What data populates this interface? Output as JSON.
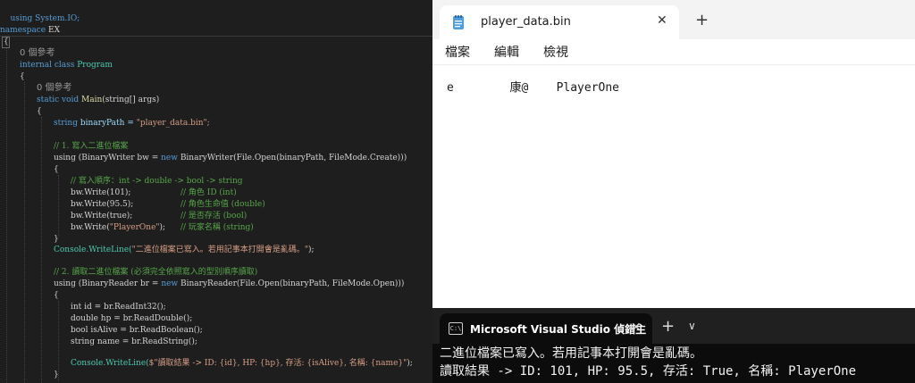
{
  "editor": {
    "using_line": "using System.IO;",
    "codelens_class": "0 個參考",
    "codelens_method": "0 個參考",
    "lines": {
      "namespace_kw": "namespace",
      "namespace_name": " EX",
      "open_ns": "{",
      "class_kw": "internal class ",
      "class_name": "Program",
      "open_class": "{",
      "static_kw": "static void ",
      "main_name": "Main",
      "main_params": "(string[] args)",
      "open_main": "{",
      "path_type": "string ",
      "path_decl": "binaryPath = ",
      "path_value": "\"player_data.bin\";",
      "comment_write": "// 1. 寫入二進位檔案",
      "using_writer_a": "using (BinaryWriter bw = ",
      "using_writer_b": "new ",
      "using_writer_c": "BinaryWriter(File.Open(binaryPath, FileMode.Create)))",
      "open_writer": "{",
      "comment_order": "// 寫入順序：int -> double -> bool -> string",
      "w1_code": "bw.Write(101);",
      "w1_comment": "// 角色 ID (int)",
      "w2_code": "bw.Write(95.5);",
      "w2_comment": "// 角色生命值 (double)",
      "w3_code": "bw.Write(true);",
      "w3_comment": "// 是否存活 (bool)",
      "w4_code_a": "bw.Write(",
      "w4_code_b": "\"PlayerOne\"",
      "w4_code_c": ");",
      "w4_comment": "// 玩家名稱 (string)",
      "close_writer": "}",
      "console1_a": "Console.WriteLine(",
      "console1_b": "\"二進位檔案已寫入。若用記事本打開會是亂碼。\"",
      "console1_c": ");",
      "comment_read": "// 2. 讀取二進位檔案 (必須完全依照寫入的型別順序讀取)",
      "using_reader_a": "using (BinaryReader br = ",
      "using_reader_b": "new ",
      "using_reader_c": "BinaryReader(File.Open(binaryPath, FileMode.Open)))",
      "open_reader": "{",
      "r1": "int id = br.ReadInt32();",
      "r2": "double hp = br.ReadDouble();",
      "r3": "bool isAlive = br.ReadBoolean();",
      "r4": "string name = br.ReadString();",
      "console2_a": "Console.WriteLine(",
      "console2_b": "$\"讀取結果 -> ID: {id}, HP: {hp}, 存活: {isAlive}, 名稱: {name}\"",
      "console2_c": ");",
      "close_reader": "}"
    }
  },
  "notepad": {
    "tab_title": "player_data.bin",
    "close_glyph": "✕",
    "add_glyph": "+",
    "menu": [
      "檔案",
      "編輯",
      "檢視"
    ],
    "content": "e        康@    PlayerOne"
  },
  "terminal": {
    "tab_title": "Microsoft Visual Studio 偵錯主",
    "icon_glyph": "C:\\",
    "close_glyph": "✕",
    "add_glyph": "+",
    "dropdown_glyph": "∨",
    "output": [
      "二進位檔案已寫入。若用記事本打開會是亂碼。",
      "讀取結果 -> ID: 101, HP: 95.5, 存活: True, 名稱: PlayerOne"
    ]
  }
}
